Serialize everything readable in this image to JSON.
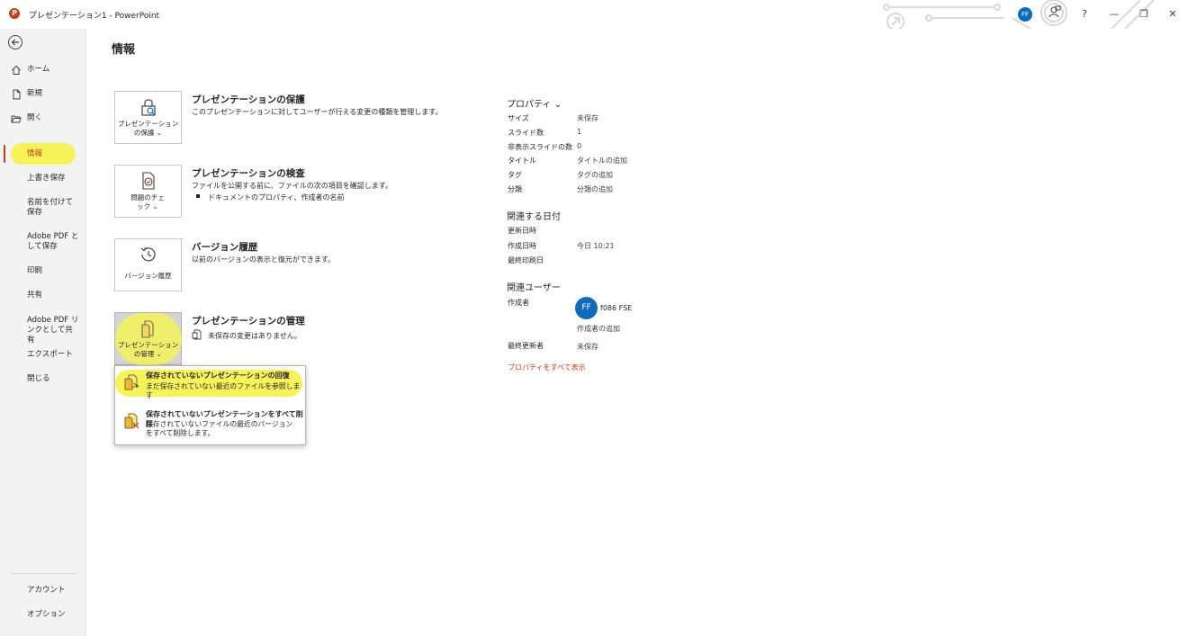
{
  "window": {
    "title": "プレゼンテーション1  -  PowerPoint",
    "logo_letter": "P",
    "avatar_initials": "FF",
    "controls": [
      "?",
      "—",
      "❐",
      "✕"
    ]
  },
  "nav": {
    "back_icon": "back-arrow-icon",
    "items": [
      {
        "label": "ホーム",
        "icon": "home-icon"
      },
      {
        "label": "新規",
        "icon": "new-file-icon"
      },
      {
        "label": "開く",
        "icon": "folder-open-icon"
      },
      {
        "label": "情報",
        "selected": true
      },
      {
        "label": "上書き保存"
      },
      {
        "label": "名前を付けて保存"
      },
      {
        "label": "Adobe PDF として保存"
      },
      {
        "label": "印刷"
      },
      {
        "label": "共有"
      },
      {
        "label": "Adobe PDF リンクとして共有"
      },
      {
        "label": "エクスポート"
      },
      {
        "label": "閉じる"
      }
    ],
    "bottom": [
      {
        "label": "アカウント"
      },
      {
        "label": "オプション"
      }
    ],
    "accent": "#c43e1c",
    "highlight": "#f5f25a"
  },
  "main": {
    "title": "情報",
    "sections": [
      {
        "tile_label": "プレゼンテーションの保護 ⌄",
        "title": "プレゼンテーションの保護",
        "desc": "このプレゼンテーションに対してユーザーが行える変更の種類を管理します。"
      },
      {
        "tile_label": "問題のチェック ⌄",
        "title": "プレゼンテーションの検査",
        "desc": "ファイルを公開する前に、ファイルの次の項目を確認します。",
        "bullet": "ドキュメントのプロパティ、作成者の名前"
      },
      {
        "tile_label": "バージョン履歴",
        "title": "バージョン履歴",
        "desc": "以前のバージョンの表示と復元ができます。"
      },
      {
        "tile_label": "プレゼンテーションの管理 ⌄",
        "title": "プレゼンテーションの管理",
        "desc": "未保存の変更はありません。"
      }
    ],
    "menu": [
      {
        "title": "保存されていないプレゼンテーションの回復",
        "desc": "まだ保存されていない最近のファイルを参照します"
      },
      {
        "title": "保存されていないプレゼンテーションをすべて削除",
        "desc": "保存されていないファイルの最近のバージョンをすべて削除します。"
      }
    ]
  },
  "properties": {
    "header": "プロパティ ⌄",
    "rows": [
      {
        "key": "サイズ",
        "value": "未保存"
      },
      {
        "key": "スライド数",
        "value": "1"
      },
      {
        "key": "非表示スライドの数",
        "value": "0"
      },
      {
        "key": "タイトル",
        "value": "タイトルの追加"
      },
      {
        "key": "タグ",
        "value": "タグの追加"
      },
      {
        "key": "分類",
        "value": "分類の追加"
      }
    ],
    "dates_header": "関連する日付",
    "dates": [
      {
        "key": "更新日時",
        "value": ""
      },
      {
        "key": "作成日時",
        "value": "今日 10:21"
      },
      {
        "key": "最終印刷日",
        "value": ""
      }
    ],
    "users_header": "関連ユーザー",
    "author_key": "作成者",
    "author_initials": "FF",
    "author_name": "f086 FSE",
    "add_author": "作成者の追加",
    "last_modified_key": "最終更新者",
    "last_modified_value": "未保存",
    "show_all": "プロパティをすべて表示"
  }
}
